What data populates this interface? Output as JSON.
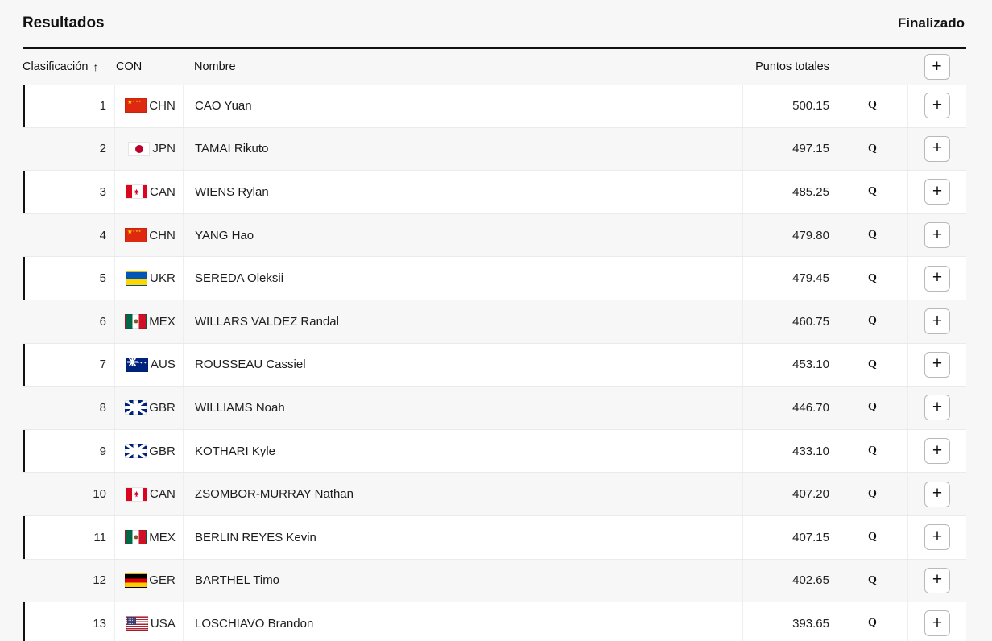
{
  "header": {
    "title": "Resultados",
    "status": "Finalizado"
  },
  "table": {
    "columns": {
      "rank": "Clasificación",
      "sort_icon": "↑",
      "con": "CON",
      "name": "Nombre",
      "points": "Puntos totales",
      "qualify": "",
      "add": "+"
    },
    "add_button_label": "+",
    "qualify_marker": "Q",
    "rows": [
      {
        "rank": "1",
        "con": "CHN",
        "name": "CAO Yuan",
        "points": "500.15",
        "q": "Q",
        "add": "+"
      },
      {
        "rank": "2",
        "con": "JPN",
        "name": "TAMAI Rikuto",
        "points": "497.15",
        "q": "Q",
        "add": "+"
      },
      {
        "rank": "3",
        "con": "CAN",
        "name": "WIENS Rylan",
        "points": "485.25",
        "q": "Q",
        "add": "+"
      },
      {
        "rank": "4",
        "con": "CHN",
        "name": "YANG Hao",
        "points": "479.80",
        "q": "Q",
        "add": "+"
      },
      {
        "rank": "5",
        "con": "UKR",
        "name": "SEREDA Oleksii",
        "points": "479.45",
        "q": "Q",
        "add": "+"
      },
      {
        "rank": "6",
        "con": "MEX",
        "name": "WILLARS VALDEZ Randal",
        "points": "460.75",
        "q": "Q",
        "add": "+"
      },
      {
        "rank": "7",
        "con": "AUS",
        "name": "ROUSSEAU Cassiel",
        "points": "453.10",
        "q": "Q",
        "add": "+"
      },
      {
        "rank": "8",
        "con": "GBR",
        "name": "WILLIAMS Noah",
        "points": "446.70",
        "q": "Q",
        "add": "+"
      },
      {
        "rank": "9",
        "con": "GBR",
        "name": "KOTHARI Kyle",
        "points": "433.10",
        "q": "Q",
        "add": "+"
      },
      {
        "rank": "10",
        "con": "CAN",
        "name": "ZSOMBOR-MURRAY Nathan",
        "points": "407.20",
        "q": "Q",
        "add": "+"
      },
      {
        "rank": "11",
        "con": "MEX",
        "name": "BERLIN REYES Kevin",
        "points": "407.15",
        "q": "Q",
        "add": "+"
      },
      {
        "rank": "12",
        "con": "GER",
        "name": "BARTHEL Timo",
        "points": "402.65",
        "q": "Q",
        "add": "+"
      },
      {
        "rank": "13",
        "con": "USA",
        "name": "LOSCHIAVO Brandon",
        "points": "393.65",
        "q": "Q",
        "add": "+"
      }
    ]
  },
  "colors": {
    "accent_bar": "#111111",
    "page_bg": "#f7f7f7",
    "row_alt_bg": "#ffffff"
  }
}
